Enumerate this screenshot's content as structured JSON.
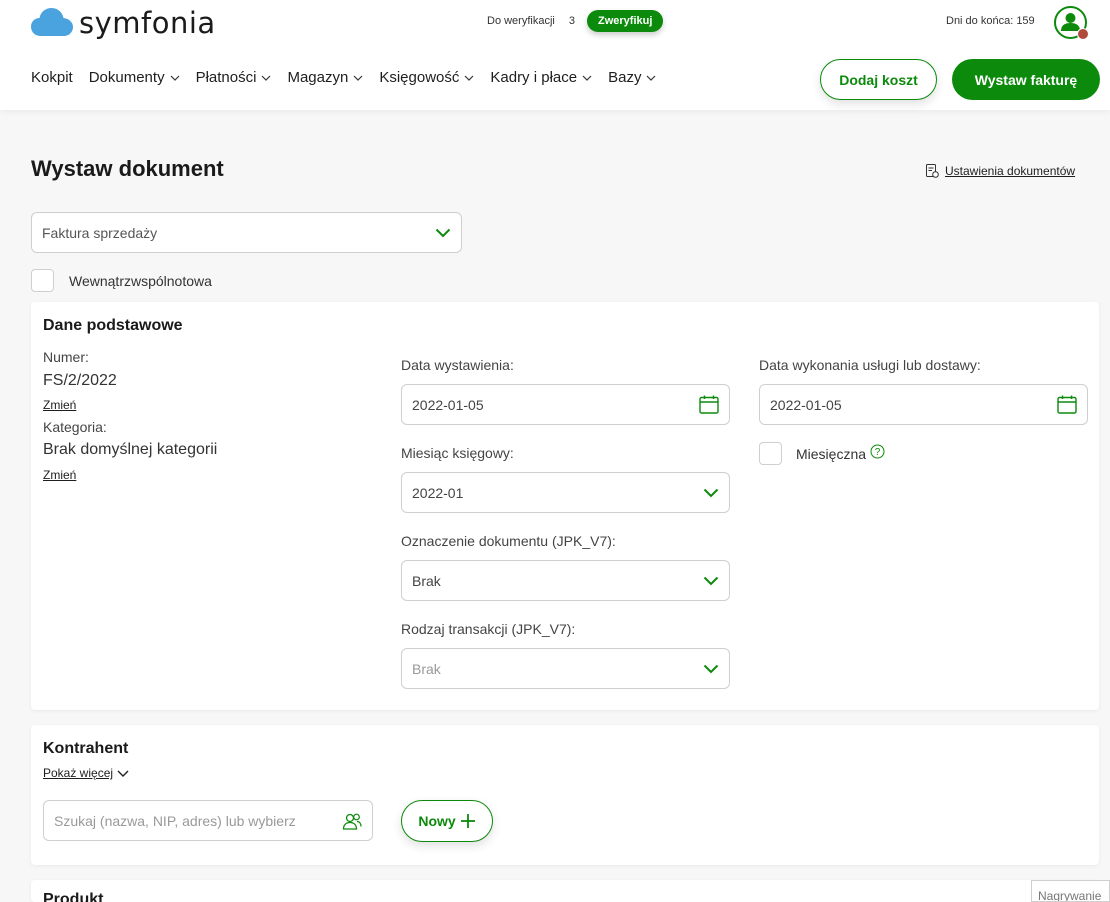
{
  "brand": {
    "name": "symfonia",
    "color": "#0c8a0c",
    "icon": "cloud-logo-icon"
  },
  "header": {
    "verification_label": "Do weryfikacji",
    "verification_count": "3",
    "verify_button": "Zweryfikuj",
    "days_left": "Dni do końca: 159",
    "avatar_icon": "user-avatar-icon"
  },
  "nav": {
    "items": [
      {
        "label": "Kokpit",
        "has_dropdown": false
      },
      {
        "label": "Dokumenty",
        "has_dropdown": true
      },
      {
        "label": "Płatności",
        "has_dropdown": true
      },
      {
        "label": "Magazyn",
        "has_dropdown": true
      },
      {
        "label": "Księgowość",
        "has_dropdown": true
      },
      {
        "label": "Kadry i płace",
        "has_dropdown": true
      },
      {
        "label": "Bazy",
        "has_dropdown": true
      }
    ],
    "add_cost": "Dodaj koszt",
    "issue_invoice": "Wystaw fakturę"
  },
  "page": {
    "title": "Wystaw dokument",
    "settings_link": "Ustawienia dokumentów",
    "document_type": "Faktura sprzedaży",
    "intra_community_label": "Wewnątrzwspólnotowa"
  },
  "basic": {
    "title": "Dane podstawowe",
    "number_label": "Numer:",
    "number_value": "FS/2/2022",
    "change": "Zmień",
    "category_label": "Kategoria:",
    "category_value": "Brak domyślnej kategorii",
    "issue_date_label": "Data wystawienia:",
    "issue_date": "2022-01-05",
    "service_date_label": "Data wykonania usługi lub dostawy:",
    "service_date": "2022-01-05",
    "monthly_label": "Miesięczna",
    "month_label": "Miesiąc księgowy:",
    "month_value": "2022-01",
    "doc_mark_label": "Oznaczenie dokumentu (JPK_V7):",
    "doc_mark_value": "Brak",
    "trans_type_label": "Rodzaj transakcji (JPK_V7):",
    "trans_type_value": "Brak"
  },
  "contractor": {
    "title": "Kontrahent",
    "show_more": "Pokaż więcej",
    "search_placeholder": "Szukaj (nazwa, NIP, adres) lub wybierz",
    "new_button": "Nowy"
  },
  "product": {
    "title": "Produkt"
  },
  "footer": {
    "recording": "Nagrywanie"
  }
}
